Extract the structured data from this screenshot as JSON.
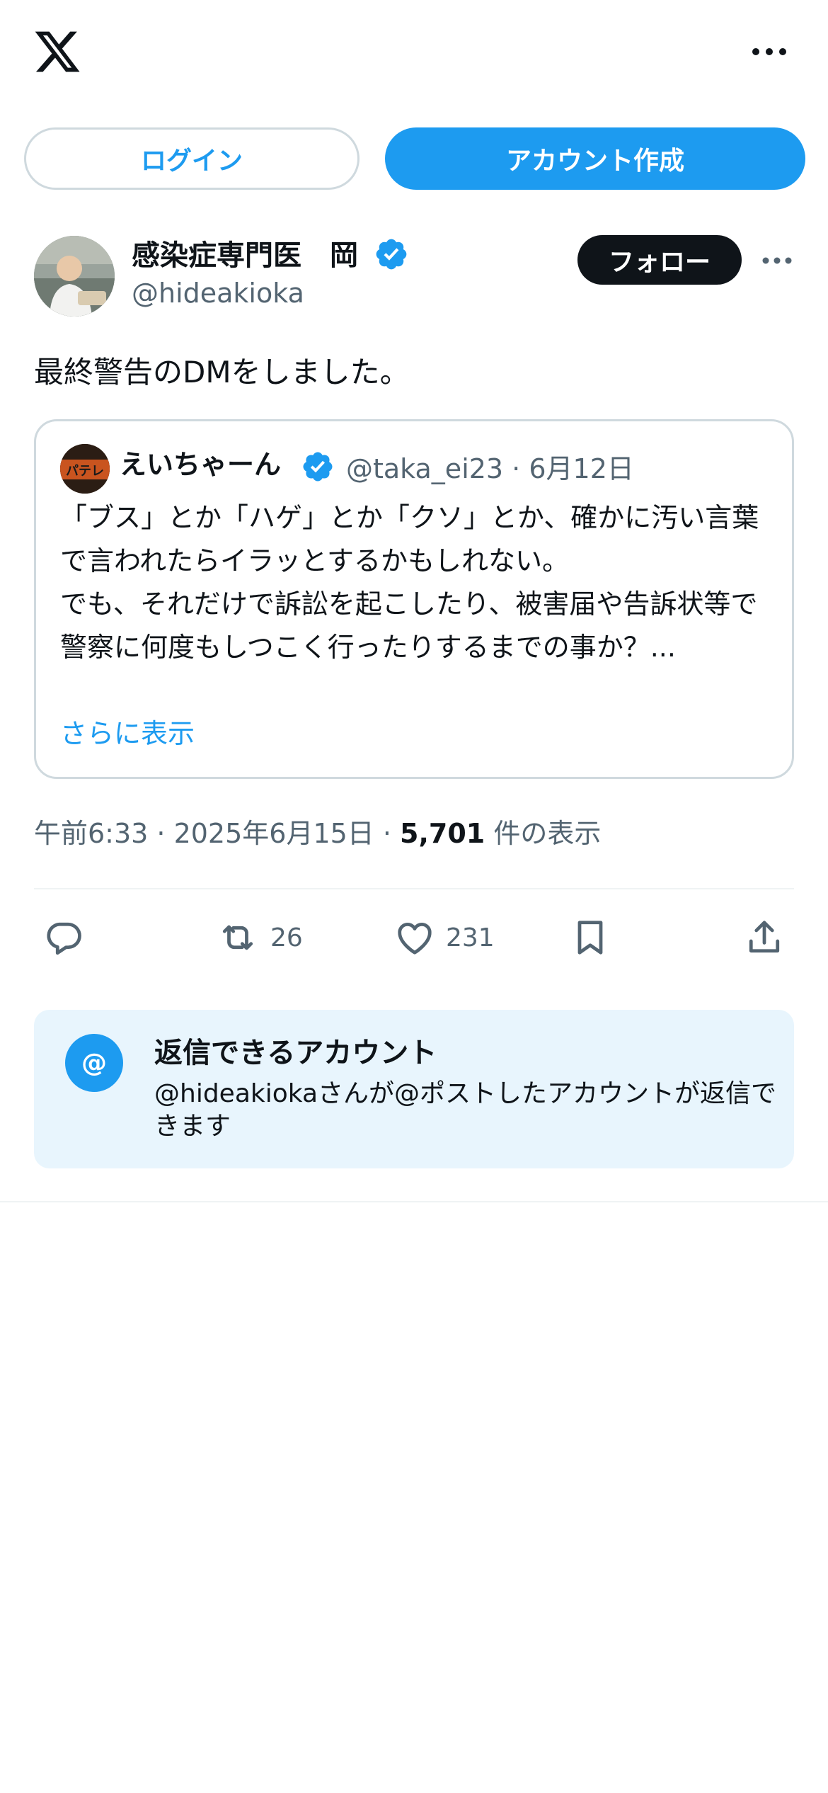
{
  "topbar": {
    "logo_icon": "x-logo-icon",
    "more_icon": "more-horizontal-icon"
  },
  "auth": {
    "login_label": "ログイン",
    "signup_label": "アカウント作成"
  },
  "post": {
    "author_name": "感染症専門医　岡",
    "author_handle": "@hideakioka",
    "follow_label": "フォロー",
    "text": "最終警告のDMをしました。",
    "time": "午前6:33 · 2025年6月15日 · ",
    "views": "5,701",
    "views_suffix": " 件の表示"
  },
  "quote": {
    "name": "えいちゃーん",
    "meta": "@taka_ei23 · 6月12日",
    "avatar_text": "パテレ",
    "body": "「ブス」とか「ハゲ」とか「クソ」とか、確かに汚い言葉で言われたらイラッとするかもしれない。\nでも、それだけで訴訟を起こしたり、被害届や告訴状等で警察に何度もしつこく行ったりするまでの事か？...",
    "show_more": "さらに表示"
  },
  "actions": {
    "reply_count": "",
    "retweet_count": "26",
    "like_count": "231"
  },
  "reply_info": {
    "icon_text": "@",
    "title": "返信できるアカウント",
    "description": "@hideakiokaさんが@ポストしたアカウントが返信できます"
  },
  "colors": {
    "accent": "#1d9bf0",
    "text": "#0f1419",
    "muted": "#536471",
    "reply_bg": "#e8f5fd"
  }
}
